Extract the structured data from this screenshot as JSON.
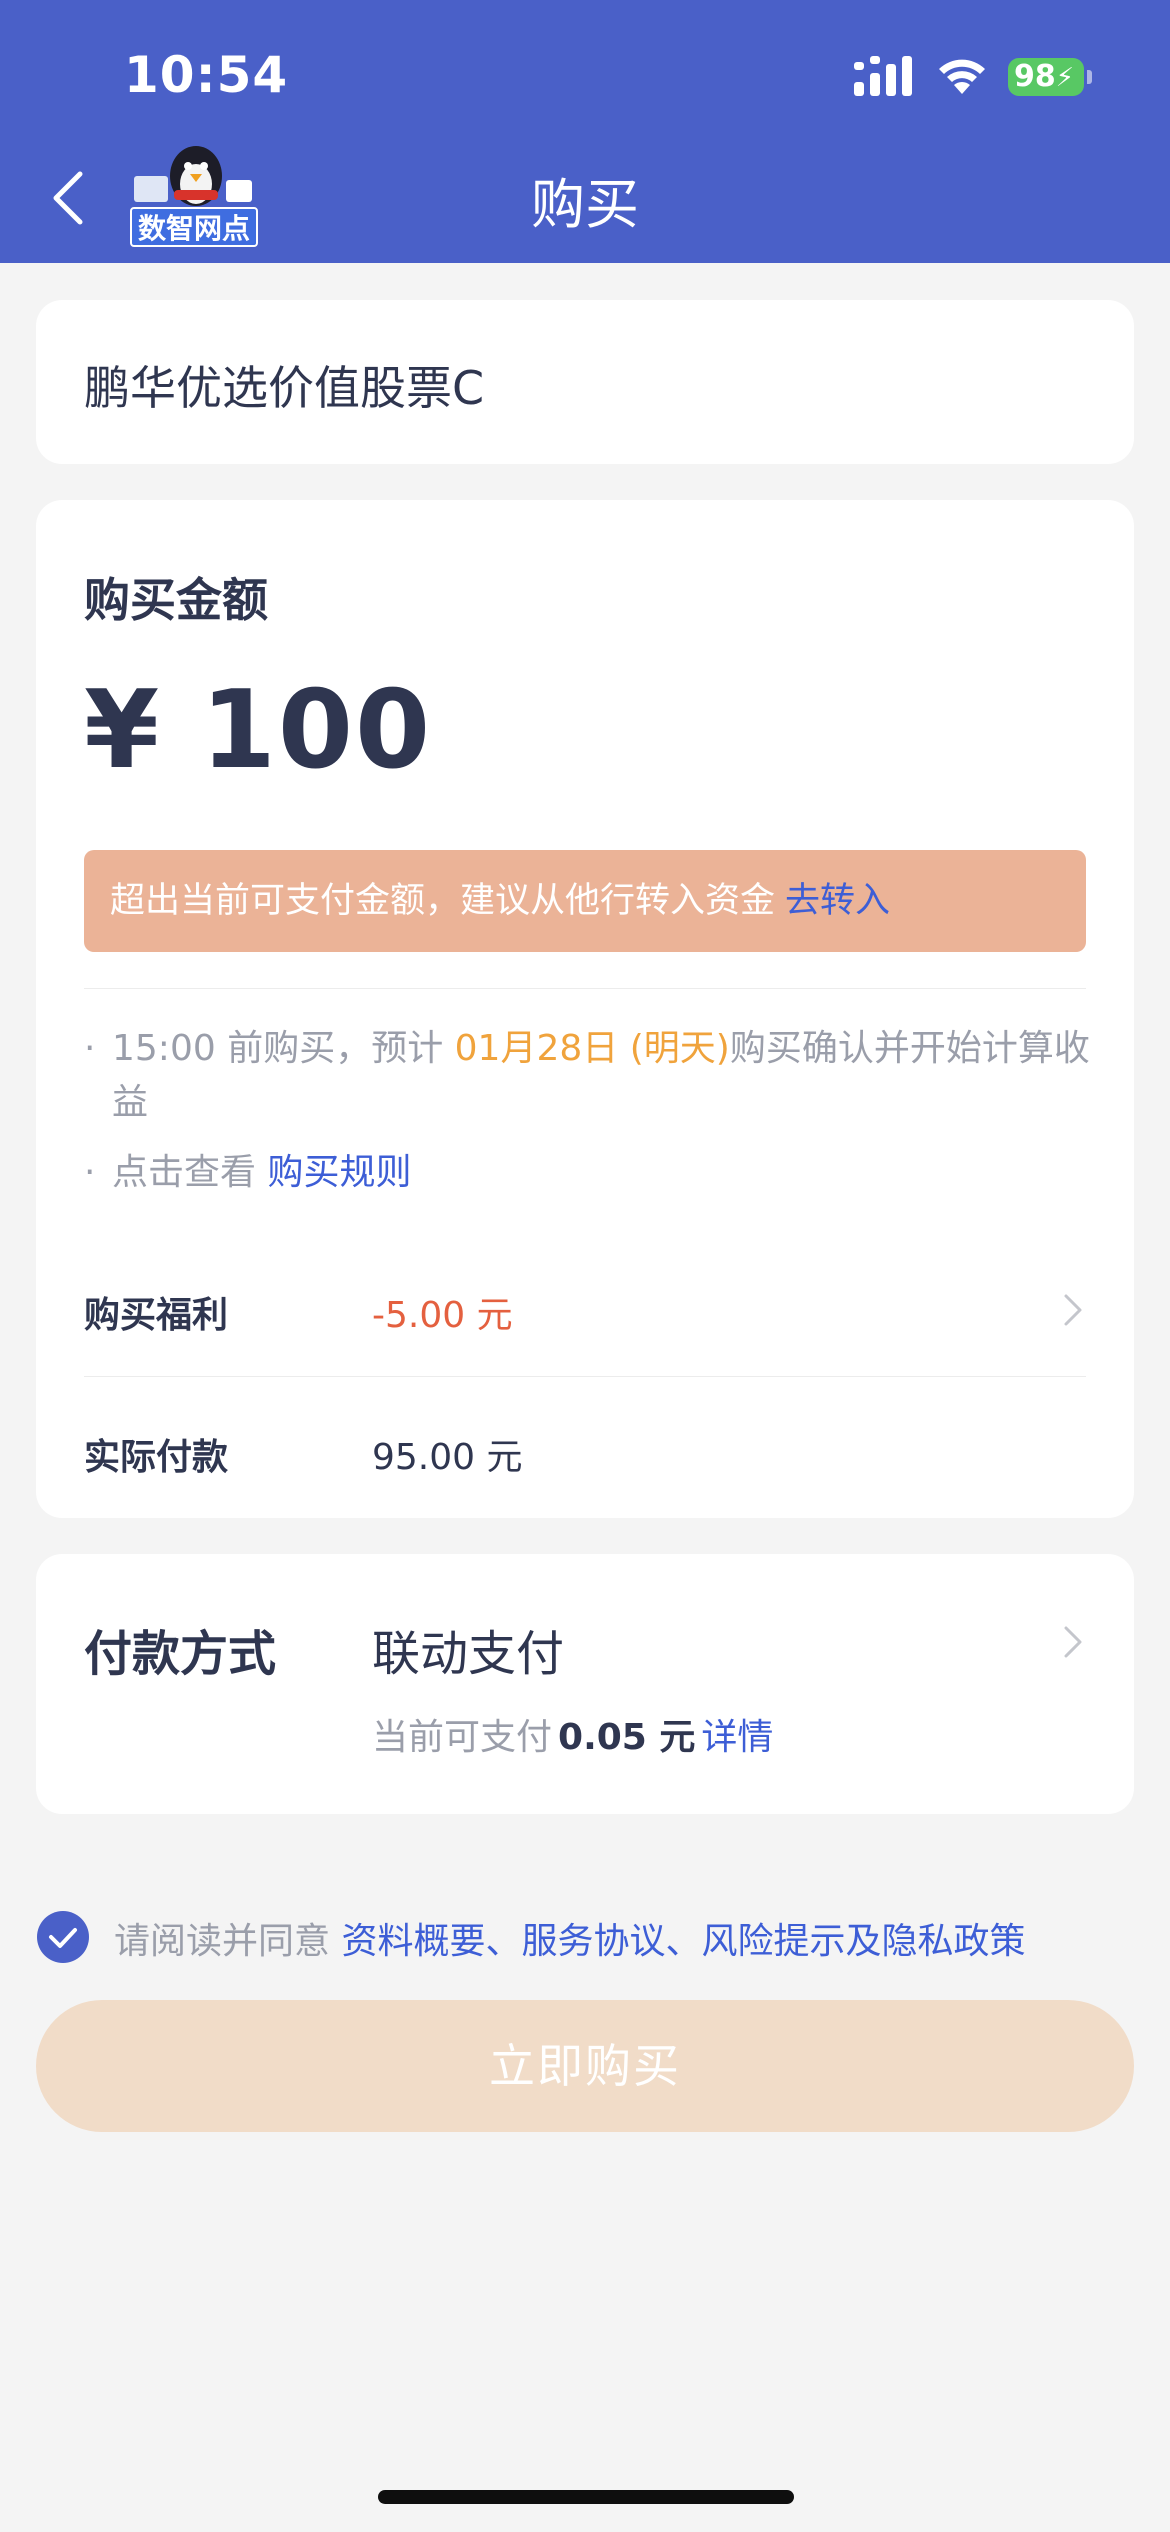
{
  "status": {
    "time": "10:54",
    "battery": "98"
  },
  "nav": {
    "title": "购买",
    "logo_text": "数智网点"
  },
  "fund": {
    "name": "鹏华优选价值股票C"
  },
  "buy": {
    "amount_label": "购买金额",
    "amount": "¥ 100",
    "warning_text": "超出当前可支付金额，建议从他行转入资金",
    "warning_link": "去转入",
    "note1_prefix": "15:00 前购买，预计",
    "note1_date": "01月28日 (明天)",
    "note1_suffix": "购买确认并开始计算收益",
    "note2_prefix": "点击查看",
    "note2_link": "购买规则"
  },
  "benefit": {
    "label": "购买福利",
    "value": "-5.00 元"
  },
  "actual": {
    "label": "实际付款",
    "value": "95.00 元"
  },
  "payment": {
    "label": "付款方式",
    "method": "联动支付",
    "available_prefix": "当前可支付",
    "available_amount": "0.05 元",
    "detail_link": "详情"
  },
  "agreement": {
    "prefix": "请阅读并同意",
    "links": "资料概要、服务协议、风险提示及隐私政策"
  },
  "button": {
    "label": "立即购买"
  },
  "colors": {
    "header": "#4a60c8",
    "warning_bg": "#ebb397",
    "accent_link": "#3d5ed6",
    "negative": "#e4603f",
    "date_highlight": "#f0a33c",
    "button_disabled": "#f1dcc8"
  },
  "icons": [
    "signal-icon",
    "wifi-icon",
    "battery-icon",
    "back-arrow-icon",
    "penguin-logo-icon",
    "chevron-right-icon",
    "check-circle-icon"
  ]
}
